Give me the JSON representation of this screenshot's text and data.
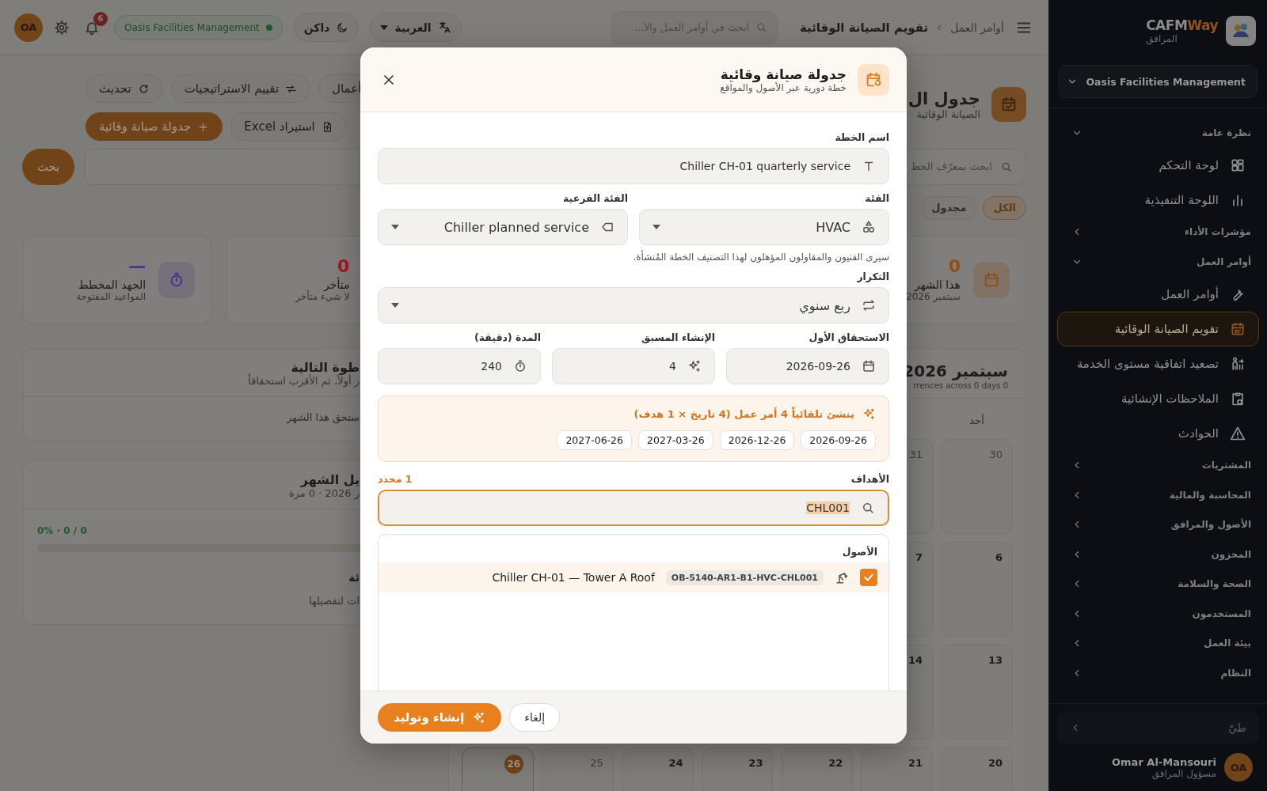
{
  "topbar": {
    "breadcrumb": [
      "أوامر العمل",
      "تقويم الصيانة الوقائية"
    ],
    "search_placeholder": "ابحث في أوامر العمل والأ...",
    "language": "العربية",
    "theme": "داكن",
    "organization": "Oasis Facilities Management",
    "notifications": "6",
    "avatar": "OA"
  },
  "page": {
    "title": "جدول ال",
    "subtitle": "الصيانة الوقائية",
    "actions": [
      {
        "label": "أعمال",
        "kind": "plain"
      },
      {
        "label": "تقييم الاستراتيجيات",
        "kind": "plain"
      },
      {
        "label": "تحديث",
        "kind": "plain"
      }
    ],
    "actions_2": [
      {
        "label": "استيراد Excel",
        "kind": "plain"
      },
      {
        "label": "جدولة صيانة وقائية",
        "kind": "primary"
      }
    ],
    "search_placeholder": "ابحث بمعرّف الخط",
    "search_button": "بحث",
    "filters": [
      {
        "label": "الكل",
        "selected": true
      },
      {
        "label": "مجدول",
        "selected": false
      }
    ]
  },
  "stats": [
    {
      "value": "0",
      "label": "هذا الشهر",
      "sub": "سبتمبر 2026",
      "color": "#8f4f14"
    },
    {
      "value": "0",
      "label": "متأخر",
      "sub": "لا شيء متأخر",
      "color": "#a3171c"
    },
    {
      "value": "—",
      "label": "الجهد المخطط",
      "sub": "المواعيد المفتوحة",
      "color": "#4b2f8f"
    }
  ],
  "next_step": {
    "title": "طوة التالية",
    "subtitle": "ر أولاً، ثم الأقرب استحقاقاً",
    "empty": "ستحق هذا الشهر"
  },
  "month_breakdown": {
    "title": "يل الشهر",
    "subtitle": "ر 2026 · 0 مرة",
    "progress_label": "0% · 0 / 0",
    "level": 0,
    "empty_title": "ئة",
    "empty_text": "ات لتفصيلها"
  },
  "calendar": {
    "title": "سبتمبر 2026",
    "subtitle": "rrences across 0 days 0",
    "weekdays": [
      "أحد"
    ],
    "weeks": [
      {
        "days": [
          {
            "label": "30",
            "muted": true,
            "today": false
          },
          {
            "label": "31",
            "muted": true,
            "today": false
          }
        ]
      },
      {
        "days": [
          {
            "label": "6",
            "muted": false,
            "today": false
          },
          {
            "label": "7",
            "muted": false,
            "today": false
          }
        ]
      },
      {
        "days": [
          {
            "label": "13",
            "muted": false,
            "today": false
          },
          {
            "label": "14",
            "muted": false,
            "today": false
          }
        ]
      },
      {
        "days": [
          {
            "label": "20",
            "muted": false,
            "today": false
          },
          {
            "label": "21",
            "muted": false,
            "today": false
          },
          {
            "label": "22",
            "muted": false,
            "today": false
          },
          {
            "label": "23",
            "muted": false,
            "today": false
          },
          {
            "label": "24",
            "muted": false,
            "today": false
          },
          {
            "label": "25",
            "muted": true,
            "today": false
          },
          {
            "label": "26",
            "muted": false,
            "today": true
          }
        ]
      }
    ]
  },
  "sidebar": {
    "brand_prefix": "CAFM",
    "brand_suffix": "Way",
    "brand_subtitle": "المرافق",
    "organization": "Oasis Facilities Management",
    "groups": [
      {
        "label": "نظرة عامة",
        "expanded": true,
        "items": [
          {
            "label": "لوحة التحكم",
            "selected": false
          },
          {
            "label": "اللوحة التنفيذية",
            "selected": false
          }
        ]
      },
      {
        "label": "مؤشرات الأداء",
        "expanded": false
      },
      {
        "label": "أوامر العمل",
        "expanded": true,
        "items": [
          {
            "label": "أوامر العمل",
            "selected": false
          },
          {
            "label": "تقويم الصيانة الوقائية",
            "selected": true
          },
          {
            "label": "تصعيد اتفاقية مستوى الخدمة",
            "selected": false
          },
          {
            "label": "الملاحظات الإنشائية",
            "selected": false
          },
          {
            "label": "الحوادث",
            "selected": false
          }
        ]
      },
      {
        "label": "المشتريات",
        "expanded": false
      },
      {
        "label": "المحاسبة والمالية",
        "expanded": false
      },
      {
        "label": "الأصول والمرافق",
        "expanded": false
      },
      {
        "label": "المخزون",
        "expanded": false
      },
      {
        "label": "الصحة والسلامة",
        "expanded": false
      },
      {
        "label": "المستخدمون",
        "expanded": false
      },
      {
        "label": "بيئة العمل",
        "expanded": false
      },
      {
        "label": "النظام",
        "expanded": false
      }
    ],
    "collapse": "طيّ",
    "user": {
      "name": "Omar Al-Mansouri",
      "role": "مسؤول المرافق",
      "initials": "OA"
    }
  },
  "dialog": {
    "title": "جدولة صيانة وقائية",
    "subtitle": "خطة دورية عبر الأصول والمواقع",
    "plan_name": {
      "label": "اسم الخطة",
      "value": "Chiller CH-01 quarterly service"
    },
    "category": {
      "label": "الفئة",
      "value": "HVAC"
    },
    "subcategory": {
      "label": "الفئة الفرعية",
      "value": "Chiller planned service"
    },
    "hint": "سيرى الفنيون والمقاولون المؤهلون لهذا التصنيف الخطة المُنشأة.",
    "recurrence": {
      "label": "التكرار",
      "value": "ربع سنوي"
    },
    "first_due": {
      "label": "الاستحقاق الأول",
      "value": "2026-09-26"
    },
    "lead": {
      "label": "الإنشاء المسبق",
      "value": "4"
    },
    "duration": {
      "label": "المدة (دقيقة)",
      "value": "240"
    },
    "preview": {
      "text": "ينشئ تلقائياً 4 أمر عمل (4 تاريخ × 1 هدف)",
      "dates": [
        "2026-09-26",
        "2026-12-26",
        "2027-03-26",
        "2027-06-26"
      ]
    },
    "targets": {
      "label": "الأهداف",
      "count": "1 محدد",
      "search_value": "CHL001",
      "group": "الأصول",
      "items": [
        {
          "code": "OB-5140-AR1-B1-HVC-CHL001",
          "name": "Chiller CH-01 — Tower A Roof",
          "checked": true
        }
      ]
    },
    "cancel": "إلغاء",
    "submit": "إنشاء وتوليد"
  }
}
